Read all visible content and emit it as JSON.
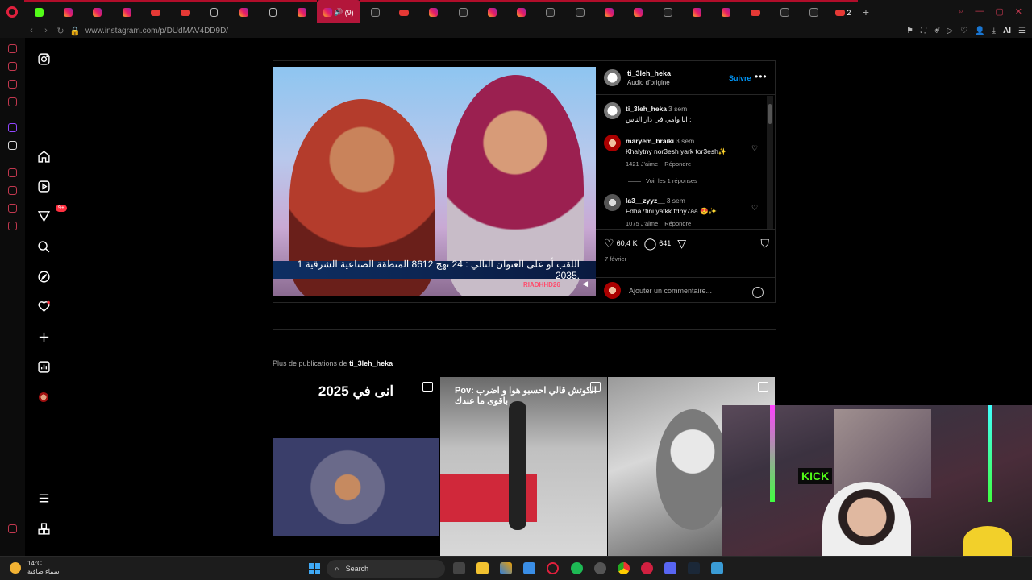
{
  "browser": {
    "url": "www.instagram.com/p/DUdMAV4DD9D/",
    "active_tab_count": "(9)",
    "yt_tab_count": "2",
    "ai_label": "AI",
    "tabs": [
      "opera",
      "kick",
      "instagram",
      "instagram",
      "instagram",
      "youtube",
      "youtube",
      "document",
      "instagram",
      "document",
      "instagram",
      "instagram-active",
      "tiktok",
      "youtube",
      "instagram",
      "tiktok",
      "instagram",
      "instagram",
      "tiktok",
      "tiktok",
      "instagram",
      "instagram",
      "tiktok",
      "instagram",
      "instagram",
      "youtube",
      "tiktok",
      "tiktok",
      "youtube"
    ]
  },
  "post": {
    "author": "ti_3leh_heka",
    "audio": "Audio d'origine",
    "follow_label": "Suivre",
    "more_label": "•••",
    "ticker_text": "اللقب أو على العنوان التالي : 24 نهج 8612 المنطقة الصناعية الشرقية 1 .2035",
    "channel_tag": "RIADHHD26",
    "caption": {
      "user": "ti_3leh_heka",
      "time": "3 sem",
      "text": "انا وامي في دار الناس :"
    },
    "comments": [
      {
        "user": "maryem_braiki",
        "time": "3 sem",
        "text": "Khalytny nor3esh yark tor3esh✨",
        "likes": "1421 J'aime",
        "reply": "Répondre"
      },
      {
        "user": "la3__zyyz__",
        "time": "3 sem",
        "text": "Fdha7tini yatkk fdhy7aa 😍✨",
        "likes": "1075 J'aime",
        "reply": "Répondre"
      }
    ],
    "view_replies": "Voir les 1 réponses",
    "likes_count": "60,4 K",
    "comments_count": "641",
    "date": "7 février",
    "add_comment_placeholder": "Ajouter un commentaire..."
  },
  "more_posts": {
    "prefix": "Plus de publications de",
    "author": "ti_3leh_heka",
    "items": [
      {
        "title": "انى في 2025"
      },
      {
        "title": "Pov: الكوتش قالي احسبو هوا و اضرب باقوى ما عندك"
      },
      {
        "title": ""
      }
    ]
  },
  "webcam": {
    "sign": "KICK"
  },
  "taskbar": {
    "temperature": "14°C",
    "weather_desc": "سماء صافية",
    "search_label": "Search"
  }
}
